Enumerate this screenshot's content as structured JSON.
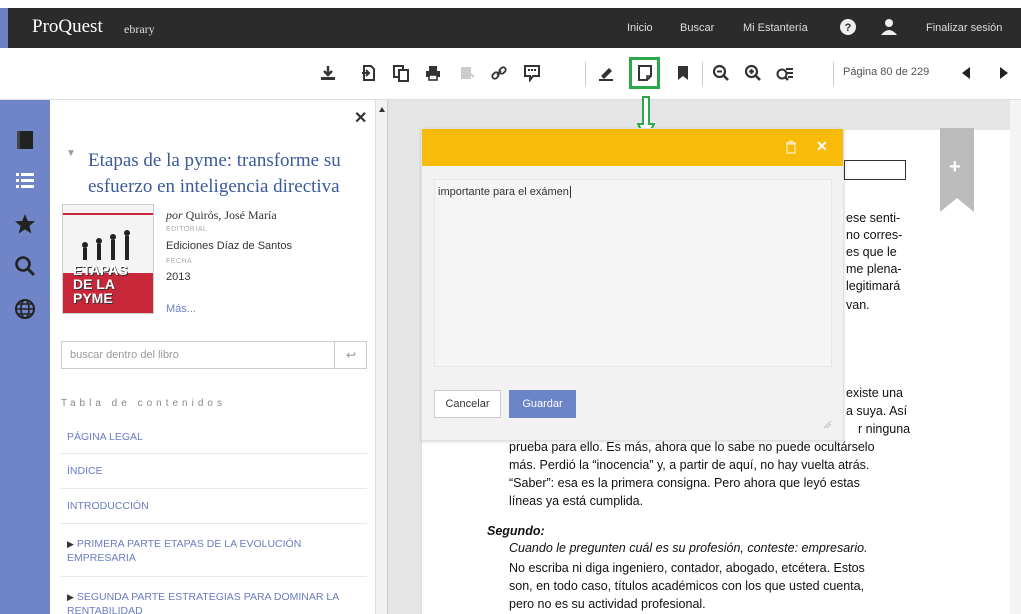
{
  "header": {
    "logo": "ProQuest",
    "logo_sub": "ebrary",
    "nav": {
      "home": "Inicio",
      "search": "Buscar",
      "shelf": "Mi Estantería",
      "logout": "Finalizar sesión"
    }
  },
  "toolbar": {
    "icons": [
      "download-icon",
      "download-chapter-icon",
      "copy-icon",
      "print-icon",
      "highlight-disabled-icon",
      "link-icon",
      "comment-icon",
      "highlighter-icon",
      "note-icon",
      "bookmark-icon",
      "zoom-out-icon",
      "zoom-in-icon",
      "fit-page-icon"
    ],
    "page_label": "Página 80 de 229"
  },
  "rail": {
    "icons": [
      "book-icon",
      "toc-list-icon",
      "star-icon",
      "search-icon",
      "globe-icon"
    ]
  },
  "sidebar": {
    "title": "Etapas de la pyme: transforme su esfuerzo en inteligencia directiva",
    "cover_text": "ETAPAS\nDE LA PYME",
    "author_prefix": "por",
    "author": "Quirós, José María",
    "publisher_label": "EDITORIAL",
    "publisher": "Ediciones Díaz de Santos",
    "date_label": "FECHA",
    "date": "2013",
    "more": "Más...",
    "search_placeholder": "buscar dentro del libro",
    "search_button": "↩",
    "toc_heading": "Tabla de contenidos",
    "toc": [
      "PÁGINA LEGAL",
      "ÍNDICE",
      "INTRODUCCIÓN",
      "PRIMERA PARTE ETAPAS DE LA EVOLUCIÓN EMPRESARIA",
      "SEGUNDA PARTE ESTRATEGIAS PARA DOMINAR LA RENTABILIDAD"
    ]
  },
  "note": {
    "text": "importante para el exámen",
    "cancel": "Cancelar",
    "save": "Guardar"
  },
  "page": {
    "right_lines": [
      "ese senti-",
      "no corres-",
      "es que le",
      "me plena-",
      "legitimará",
      "van."
    ],
    "right_lines2": [
      "existe una",
      "a suya. Así",
      "r ninguna"
    ],
    "body_lines": [
      "prueba para ello. Es más, ahora que lo sabe no puede ocultárselo",
      "más. Perdió la “inocencia” y, a partir de aquí, no hay vuelta atrás.",
      "“Saber”: esa es la primera consigna. Pero ahora que leyó estas",
      "líneas ya está cumplida."
    ],
    "segundo": "Segundo:",
    "italic": "Cuando le pregunten cuál es su profesión, conteste: empresario.",
    "body_lines2": [
      "No escriba ni diga ingeniero, contador, abogado, etcétera. Estos",
      "son, en todo caso, títulos académicos con los que usted cuenta,",
      "pero no es su actividad profesional."
    ]
  },
  "colors": {
    "accent": "#6d7fc4",
    "note_header": "#f9bb0a",
    "highlight": "#2aa84a",
    "topbar": "#2b2b2b"
  }
}
